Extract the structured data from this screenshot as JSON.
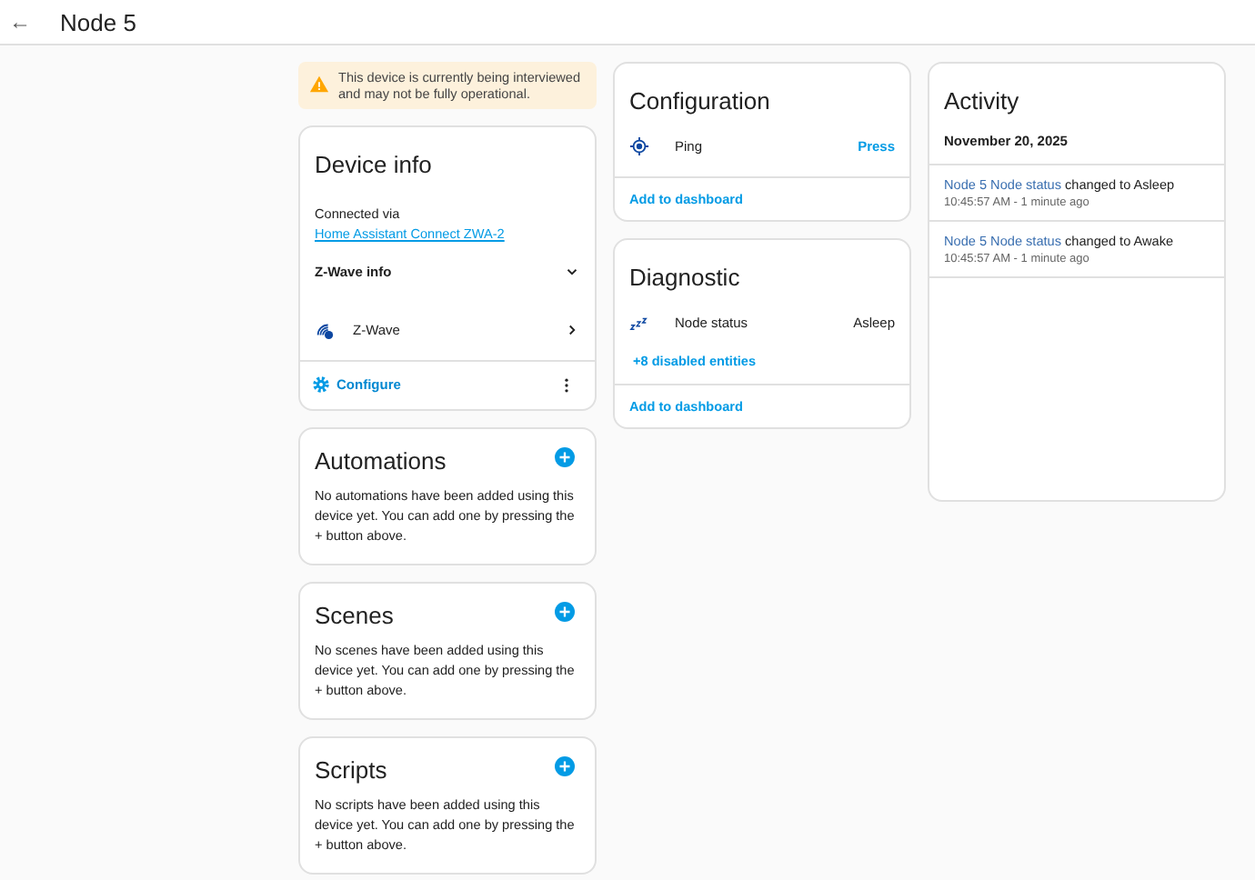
{
  "header": {
    "back": "←",
    "title": "Node 5"
  },
  "warning": "This device is currently being interviewed and may not be fully operational.",
  "device_info": {
    "title": "Device info",
    "connected_prefix": "Connected via ",
    "connected_link": "Home Assistant Connect ZWA-2",
    "zwave_info": {
      "label": "Z-Wave info",
      "expanded": false
    },
    "integration": "Z-Wave",
    "configure": "Configure"
  },
  "sections": [
    {
      "title": "Automations",
      "text": "No automations have been added using this device yet. You can add one by pressing the + button above."
    },
    {
      "title": "Scenes",
      "text": "No scenes have been added using this device yet. You can add one by pressing the + button above."
    },
    {
      "title": "Scripts",
      "text": "No scripts have been added using this device yet. You can add one by pressing the + button above."
    }
  ],
  "configuration": {
    "title": "Configuration",
    "rows": [
      {
        "kind": "button",
        "name": "Ping",
        "value": "Press"
      }
    ],
    "footer": "Add to dashboard"
  },
  "diagnostic": {
    "title": "Diagnostic",
    "rows": [
      {
        "kind": "sensor",
        "name": "Node status",
        "value": "Asleep"
      }
    ],
    "disabled": "+8 disabled entities",
    "footer": "Add to dashboard"
  },
  "activity": {
    "title": "Activity",
    "date": "November 20, 2025",
    "entries": [
      {
        "entity": "Node 5 Node status",
        "message": " changed to Asleep",
        "time": "10:45:57 AM - 1 minute ago"
      },
      {
        "entity": "Node 5 Node status",
        "message": " changed to Awake",
        "time": "10:45:57 AM - 1 minute ago"
      }
    ]
  }
}
